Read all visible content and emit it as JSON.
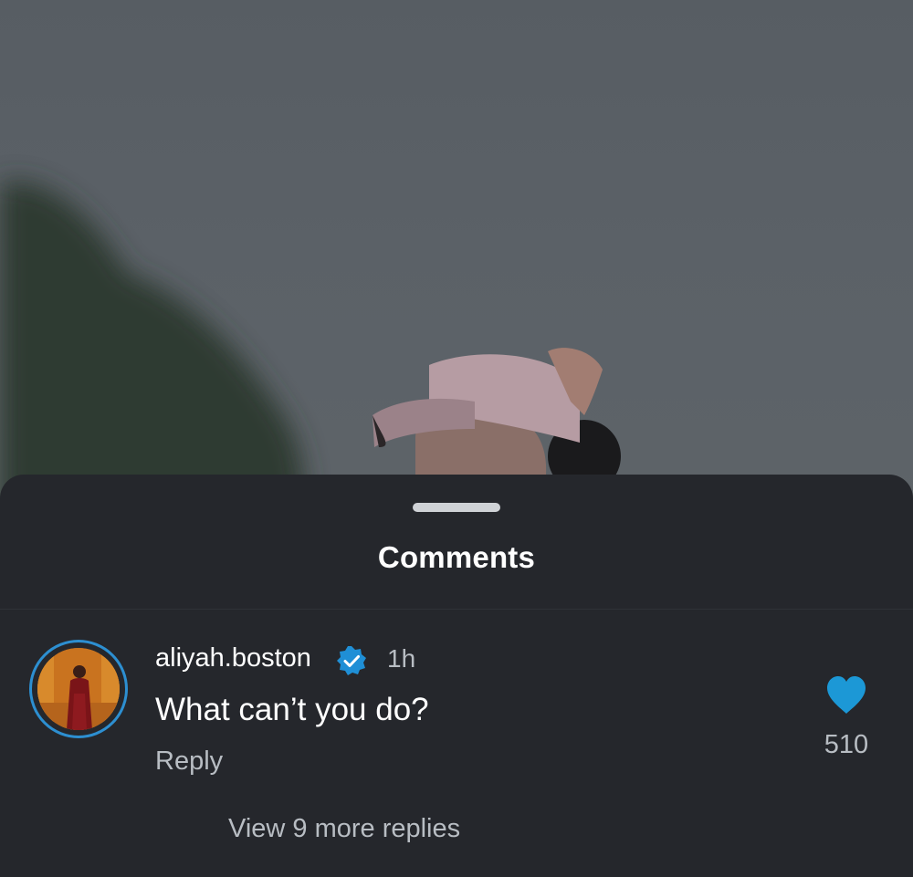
{
  "sheet": {
    "title": "Comments"
  },
  "comment": {
    "username": "aliyah.boston",
    "verified": true,
    "timestamp": "1h",
    "text": "What can’t you do?",
    "reply_label": "Reply",
    "like_count": "510",
    "liked": true,
    "view_more_label": "View 9 more replies"
  },
  "icons": {
    "verified": "verified-badge-icon",
    "like": "heart-icon"
  },
  "colors": {
    "accent": "#2d8fd1",
    "heart": "#1c98d6",
    "sheet_bg": "#25272c",
    "secondary_text": "#b8bdc3"
  }
}
